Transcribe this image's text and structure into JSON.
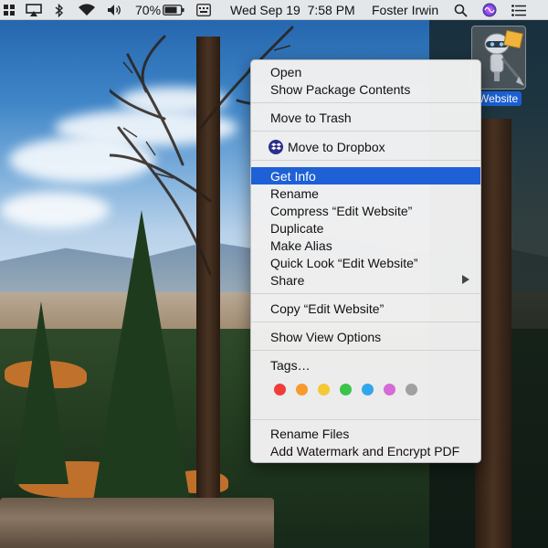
{
  "menubar": {
    "battery_percent": "70%",
    "clock": "Wed Sep 19  7:58 PM",
    "user_name": "Foster Irwin",
    "icons": [
      "window-tiling-icon",
      "airplay-icon",
      "bluetooth-icon",
      "wifi-icon",
      "volume-icon",
      "battery-icon",
      "keyboard-input-icon",
      "spotlight-search-icon",
      "siri-icon",
      "notification-center-icon"
    ]
  },
  "desktop_icon": {
    "label": "Website",
    "icon": "automator-robot-icon"
  },
  "context_menu": {
    "groups": [
      {
        "items": [
          {
            "label": "Open"
          },
          {
            "label": "Show Package Contents"
          }
        ]
      },
      {
        "items": [
          {
            "label": "Move to Trash"
          }
        ]
      },
      {
        "items": [
          {
            "label": "Move to Dropbox",
            "icon": "dropbox-icon"
          }
        ]
      },
      {
        "items": [
          {
            "label": "Get Info",
            "selected": true
          },
          {
            "label": "Rename"
          },
          {
            "label": "Compress “Edit Website”"
          },
          {
            "label": "Duplicate"
          },
          {
            "label": "Make Alias"
          },
          {
            "label": "Quick Look “Edit Website”"
          },
          {
            "label": "Share",
            "submenu": true
          }
        ]
      },
      {
        "items": [
          {
            "label": "Copy “Edit Website”"
          }
        ]
      },
      {
        "items": [
          {
            "label": "Show View Options"
          }
        ]
      },
      {
        "items": [
          {
            "label": "Tags…"
          }
        ]
      },
      {
        "items": [
          {
            "label": "Rename Files"
          },
          {
            "label": "Add Watermark and Encrypt PDF"
          }
        ]
      }
    ],
    "tag_colors": [
      {
        "name": "red",
        "color": "#f03d3a"
      },
      {
        "name": "orange",
        "color": "#f79a2e"
      },
      {
        "name": "yellow",
        "color": "#f5c933"
      },
      {
        "name": "green",
        "color": "#3cc34a"
      },
      {
        "name": "blue",
        "color": "#32a6ec"
      },
      {
        "name": "purple",
        "color": "#d66ad8"
      },
      {
        "name": "gray",
        "color": "#a0a0a0"
      }
    ]
  },
  "colors": {
    "selection": "#1e61d6",
    "menu_background": "#f0f0f0"
  }
}
